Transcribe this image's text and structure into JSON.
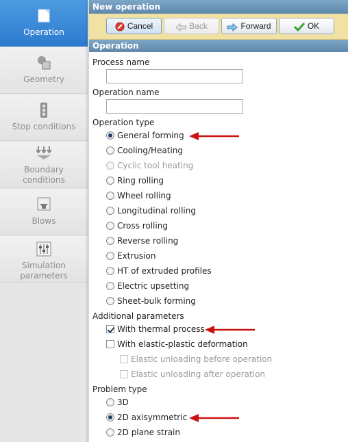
{
  "sidebar": {
    "items": [
      {
        "label": "Operation",
        "icon": "operation-icon",
        "active": true
      },
      {
        "label": "Geometry",
        "icon": "geometry-icon",
        "active": false
      },
      {
        "label": "Stop conditions",
        "icon": "traffic-light-icon",
        "active": false
      },
      {
        "label": "Boundary conditions",
        "icon": "boundary-arrows-icon",
        "active": false
      },
      {
        "label": "Blows",
        "icon": "anvil-icon",
        "active": false
      },
      {
        "label": "Simulation parameters",
        "icon": "sliders-icon",
        "active": false
      }
    ]
  },
  "header": {
    "title": "New operation"
  },
  "toolbar": {
    "cancel_label": "Cancel",
    "back_label": "Back",
    "forward_label": "Forward",
    "ok_label": "OK"
  },
  "section": {
    "title": "Operation"
  },
  "form": {
    "process_name_label": "Process name",
    "process_name_value": "",
    "operation_name_label": "Operation name",
    "operation_name_value": "",
    "operation_type_label": "Operation type",
    "operation_types": [
      {
        "label": "General forming",
        "selected": true,
        "enabled": true
      },
      {
        "label": "Cooling/Heating",
        "selected": false,
        "enabled": true
      },
      {
        "label": "Cyclic tool heating",
        "selected": false,
        "enabled": false
      },
      {
        "label": "Ring rolling",
        "selected": false,
        "enabled": true
      },
      {
        "label": "Wheel rolling",
        "selected": false,
        "enabled": true
      },
      {
        "label": "Longitudinal rolling",
        "selected": false,
        "enabled": true
      },
      {
        "label": "Cross rolling",
        "selected": false,
        "enabled": true
      },
      {
        "label": "Reverse rolling",
        "selected": false,
        "enabled": true
      },
      {
        "label": "Extrusion",
        "selected": false,
        "enabled": true
      },
      {
        "label": "HT of extruded profiles",
        "selected": false,
        "enabled": true
      },
      {
        "label": "Electric upsetting",
        "selected": false,
        "enabled": true
      },
      {
        "label": "Sheet-bulk forming",
        "selected": false,
        "enabled": true
      }
    ],
    "additional_label": "Additional parameters",
    "additional": [
      {
        "label": "With thermal process",
        "checked": true,
        "enabled": true
      },
      {
        "label": "With elastic-plastic deformation",
        "checked": false,
        "enabled": true
      },
      {
        "label": "Elastic unloading before operation",
        "checked": false,
        "enabled": false
      },
      {
        "label": "Elastic unloading after operation",
        "checked": false,
        "enabled": false
      }
    ],
    "problem_type_label": "Problem type",
    "problem_types": [
      {
        "label": "3D",
        "selected": false,
        "enabled": true
      },
      {
        "label": "2D axisymmetric",
        "selected": true,
        "enabled": true
      },
      {
        "label": "2D plane strain",
        "selected": false,
        "enabled": true
      }
    ]
  },
  "colors": {
    "accent_blue": "#2c7bd0",
    "toolbar_yellow": "#f1e2a3",
    "arrow_red": "#cc1111"
  }
}
